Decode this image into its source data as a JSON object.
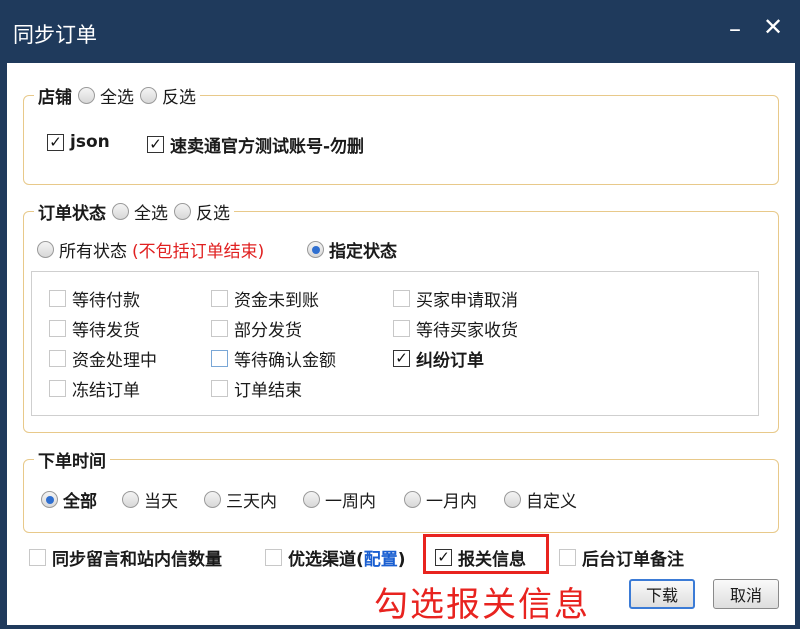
{
  "window": {
    "title": "同步订单",
    "minimize": "–",
    "close": "✕"
  },
  "store": {
    "title": "店铺",
    "select_all": "全选",
    "invert": "反选",
    "accounts": [
      {
        "label": "json",
        "checked": true
      },
      {
        "label": "速卖通官方测试账号-勿删",
        "checked": true
      }
    ]
  },
  "order_status": {
    "title": "订单状态",
    "select_all": "全选",
    "invert": "反选",
    "all_status_prefix": "所有状态",
    "all_status_note": "(不包括订单结束)",
    "specified": "指定状态",
    "items": [
      {
        "label": "等待付款",
        "checked": false
      },
      {
        "label": "资金未到账",
        "checked": false
      },
      {
        "label": "买家申请取消",
        "checked": false
      },
      {
        "label": "等待发货",
        "checked": false
      },
      {
        "label": "部分发货",
        "checked": false
      },
      {
        "label": "等待买家收货",
        "checked": false
      },
      {
        "label": "资金处理中",
        "checked": false
      },
      {
        "label": "等待确认金额",
        "checked": false
      },
      {
        "label": "纠纷订单",
        "checked": true
      },
      {
        "label": "冻结订单",
        "checked": false
      },
      {
        "label": "订单结束",
        "checked": false
      }
    ]
  },
  "order_time": {
    "title": "下单时间",
    "options": [
      "全部",
      "当天",
      "三天内",
      "一周内",
      "一月内",
      "自定义"
    ],
    "selected": "全部"
  },
  "options": {
    "sync_messages": "同步留言和站内信数量",
    "preferred_channel_prefix": "优选渠道(",
    "preferred_channel_link": "配置",
    "preferred_channel_suffix": ")",
    "customs_info": "报关信息",
    "backend_note": "后台订单备注"
  },
  "annotation": "勾选报关信息",
  "buttons": {
    "download": "下载",
    "cancel": "取消"
  },
  "colors": {
    "titlebar": "#1f3a5c",
    "accent": "#e8231f",
    "group_border": "#e8c98a"
  }
}
